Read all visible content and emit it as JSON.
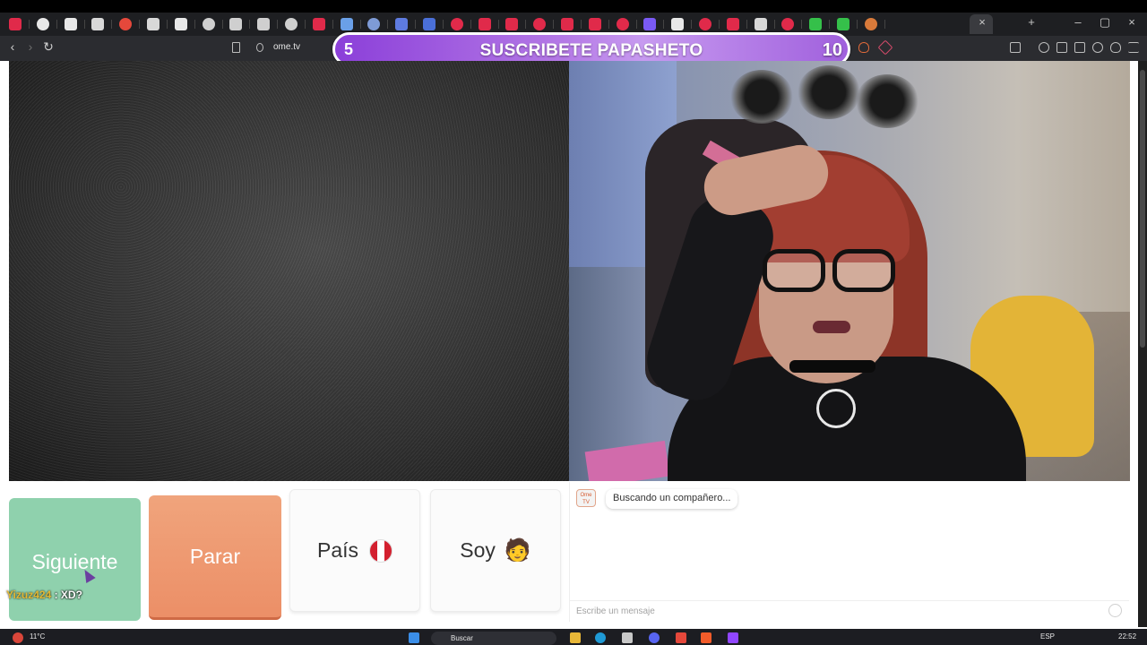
{
  "browser": {
    "url": "ome.tv",
    "tab_close_glyph": "×",
    "new_tab_glyph": "+",
    "window_controls": {
      "minimize": "–",
      "maximize": "▢",
      "close": "×"
    },
    "nav": {
      "back": "‹",
      "forward": "›",
      "reload": "↻"
    }
  },
  "banner": {
    "left_number": "5",
    "title": "SUSCRIBETE PAPASHETO",
    "right_number": "10"
  },
  "controls": {
    "next_label": "Siguiente",
    "stop_label": "Parar",
    "country_label": "País",
    "me_label": "Soy",
    "me_emoji": "🧑"
  },
  "stream_chat": {
    "user": "Yizuz424",
    "separator": " : ",
    "message": "XD?"
  },
  "chat": {
    "logo_text": "Ome TV",
    "status_message": "Buscando un compañero...",
    "input_placeholder": "Escribe un mensaje"
  },
  "taskbar": {
    "weather": "11°C",
    "search_label": "Buscar",
    "language": "ESP",
    "time": "22:52"
  },
  "colors": {
    "next_button": "#8fd1ad",
    "stop_button": "#ec8f67",
    "banner_purple": "#8b3fd9",
    "stream_username": "#e2b834"
  }
}
